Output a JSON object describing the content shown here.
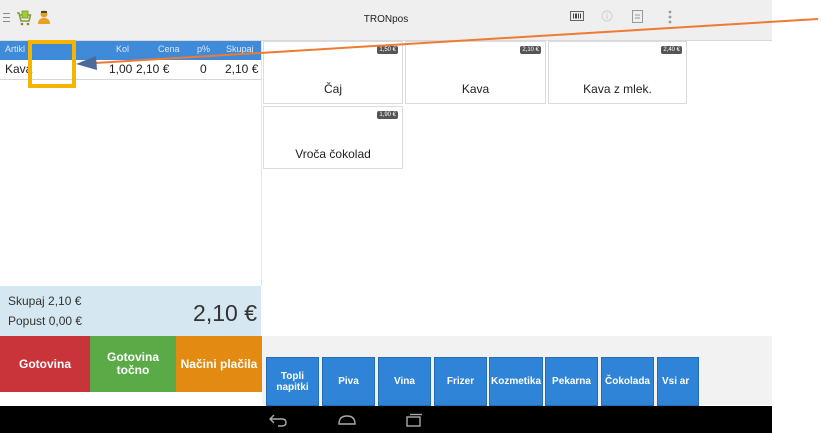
{
  "app": {
    "title": "TRONpos"
  },
  "order_table": {
    "headers": [
      "Artikl",
      "Kol",
      "Cena",
      "p%",
      "Skupaj"
    ],
    "rows": [
      {
        "article": "Kava",
        "qty": "1,00",
        "price": "2,10 €",
        "discount": "0",
        "total": "2,10 €"
      }
    ]
  },
  "totals": {
    "sum_label": "Skupaj 2,10 €",
    "discount_label": "Popust 0,00 €",
    "big_total": "2,10 €"
  },
  "payment": {
    "cash": "Gotovina",
    "cash_exact_line1": "Gotovina",
    "cash_exact_line2": "točno",
    "methods": "Načini plačila"
  },
  "products": [
    {
      "name": "Čaj",
      "price": "1,50 €"
    },
    {
      "name": "Kava",
      "price": "2,10 €"
    },
    {
      "name": "Kava z mlek.",
      "price": "2,40 €"
    },
    {
      "name": "Vroča čokolad",
      "price": "1,90 €"
    }
  ],
  "categories": [
    {
      "line1": "Topli",
      "line2": "napitki"
    },
    {
      "line1": "Piva",
      "line2": ""
    },
    {
      "line1": "Vina",
      "line2": ""
    },
    {
      "line1": "Frizer",
      "line2": ""
    },
    {
      "line1": "Kozmetika",
      "line2": ""
    },
    {
      "line1": "Pekarna",
      "line2": ""
    },
    {
      "line1": "Čokolada",
      "line2": ""
    },
    {
      "line1": "Vsi ar",
      "line2": ""
    }
  ],
  "colors": {
    "header_blue": "#3f8ad9",
    "cash_red": "#c9343b",
    "exact_green": "#5aab47",
    "methods_orange": "#e28a12",
    "category_blue": "#2f84d8",
    "annotation_orange": "#f07a30",
    "highlight_yellow": "#f5b400"
  }
}
